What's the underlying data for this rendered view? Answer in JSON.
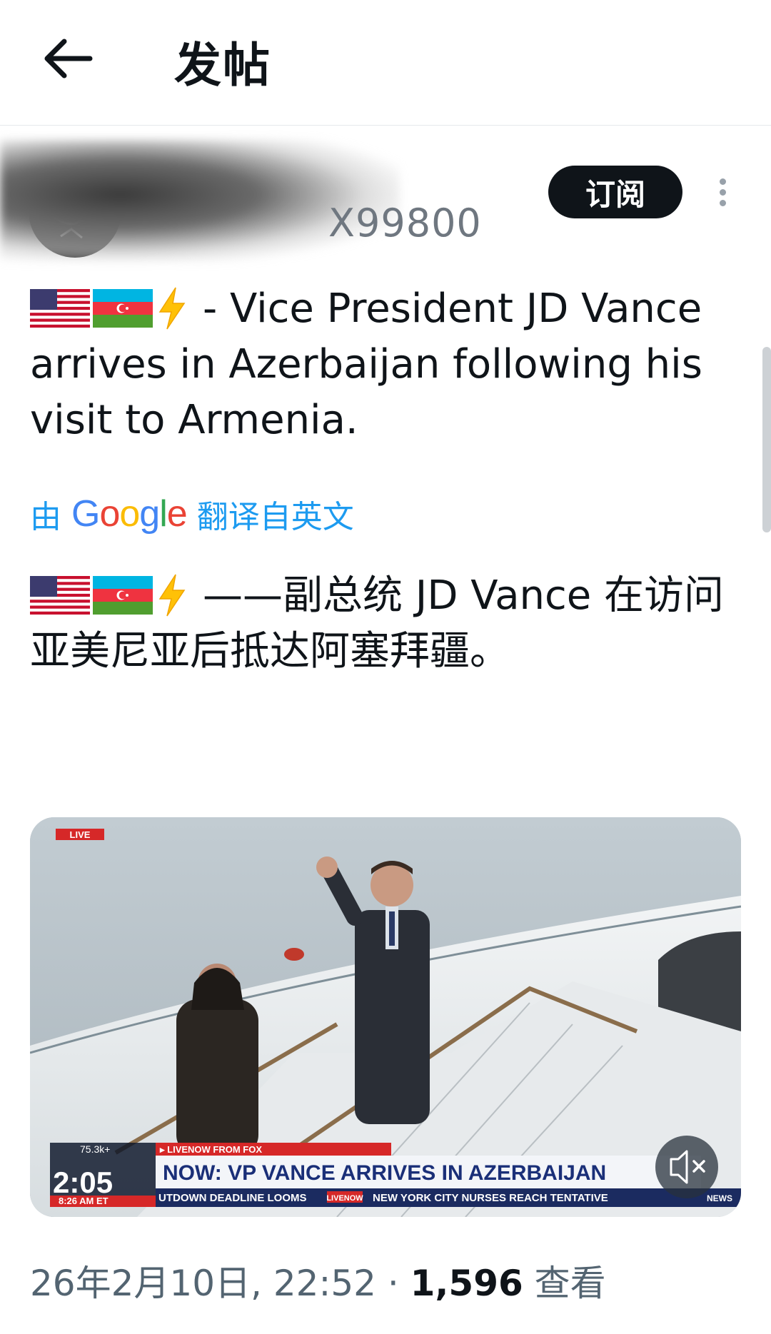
{
  "header": {
    "title": "发帖"
  },
  "author": {
    "handle": "X99800",
    "subscribe_label": "订阅"
  },
  "post": {
    "original_text": "- Vice President JD Vance arrives in Azerbaijan following his visit to Armenia.",
    "translation_prefix": "由",
    "translation_provider": "Google",
    "translation_suffix": "翻译自英文",
    "translated_text": "——副总统 JD Vance 在访问亚美尼亚后抵达阿塞拜疆。"
  },
  "video": {
    "live_badge": "LIVE",
    "view_count": "75.3k+",
    "source": "▸ LIVENOW FROM FOX",
    "clock": "2:05",
    "time_zone_line": "8:26 AM ET",
    "headline": "NOW: VP VANCE ARRIVES IN AZERBAIJAN",
    "ticker_left": "UTDOWN DEADLINE LOOMS",
    "ticker_logo": "LIVENOW",
    "ticker_right": "NEW YORK CITY NURSES REACH TENTATIVE",
    "network_badge": "NEWS"
  },
  "meta": {
    "date_time": "26年2月10日, 22:52 · ",
    "views_count": "1,596",
    "views_label": " 查看"
  }
}
